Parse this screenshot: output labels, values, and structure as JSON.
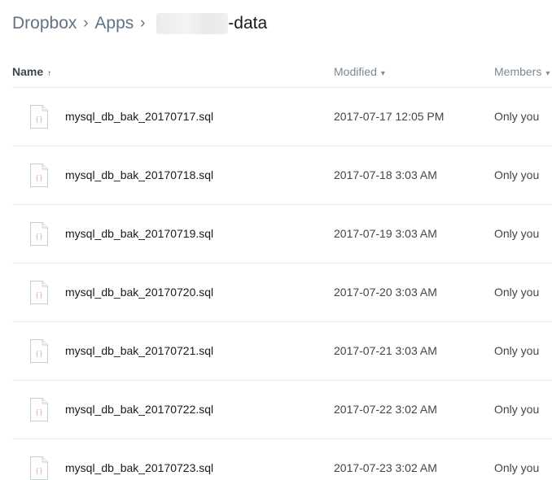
{
  "breadcrumb": {
    "root": "Dropbox",
    "apps": "Apps",
    "folder_suffix": "-data"
  },
  "columns": {
    "name": "Name",
    "name_sort": "↑",
    "modified": "Modified",
    "modified_sort": "▾",
    "members": "Members",
    "members_sort": "▾"
  },
  "icons": {
    "file": "code-file-icon",
    "accent": "#e8a591"
  },
  "files": [
    {
      "name": "mysql_db_bak_20170717.sql",
      "modified": "2017-07-17 12:05 PM",
      "members": "Only you"
    },
    {
      "name": "mysql_db_bak_20170718.sql",
      "modified": "2017-07-18 3:03 AM",
      "members": "Only you"
    },
    {
      "name": "mysql_db_bak_20170719.sql",
      "modified": "2017-07-19 3:03 AM",
      "members": "Only you"
    },
    {
      "name": "mysql_db_bak_20170720.sql",
      "modified": "2017-07-20 3:03 AM",
      "members": "Only you"
    },
    {
      "name": "mysql_db_bak_20170721.sql",
      "modified": "2017-07-21 3:03 AM",
      "members": "Only you"
    },
    {
      "name": "mysql_db_bak_20170722.sql",
      "modified": "2017-07-22 3:02 AM",
      "members": "Only you"
    },
    {
      "name": "mysql_db_bak_20170723.sql",
      "modified": "2017-07-23 3:02 AM",
      "members": "Only you"
    }
  ]
}
